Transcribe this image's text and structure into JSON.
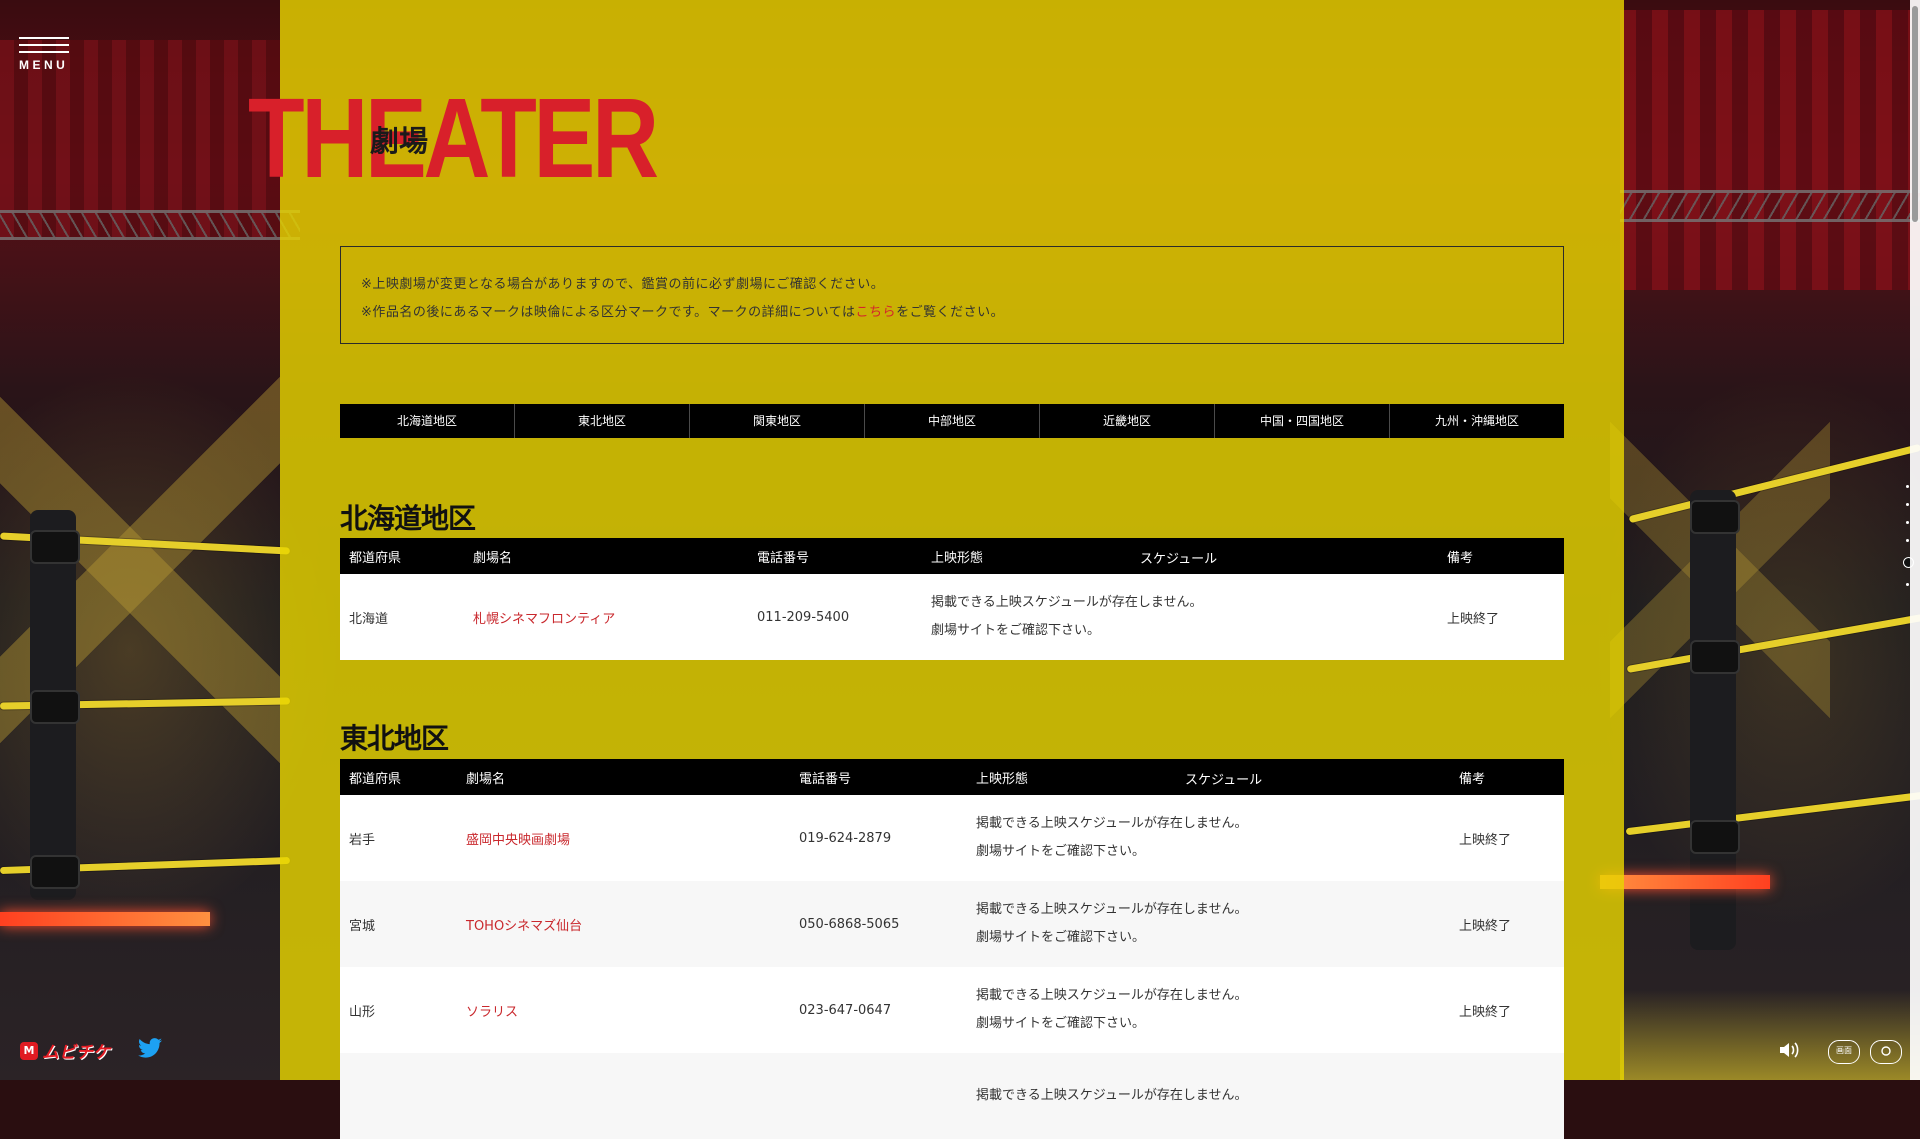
{
  "colors": {
    "accent": "#d8202a",
    "panel": "#e8d400",
    "header_bg": "#000000",
    "link": "#c9282d"
  },
  "menu": {
    "label": "MENU",
    "icon": "hamburger-icon"
  },
  "title": {
    "en": "THEATER",
    "jp": "劇場"
  },
  "notice": {
    "line1": "※上映劇場が変更となる場合がありますので、鑑賞の前に必ず劇場にご確認ください。",
    "line2_before": "※作品名の後にあるマークは映倫による区分マークです。マークの詳細については",
    "line2_link": "こちら",
    "line2_after": "をご覧ください。"
  },
  "tabs": [
    "北海道地区",
    "東北地区",
    "関東地区",
    "中部地区",
    "近畿地区",
    "中国・四国地区",
    "九州・沖縄地区"
  ],
  "columns": {
    "pref": "都道府県",
    "theater": "劇場名",
    "tel": "電話番号",
    "format": "上映形態",
    "schedule": "スケジュール",
    "note": "備考"
  },
  "regions": [
    {
      "name": "北海道地区",
      "rows": [
        {
          "pref": "北海道",
          "theater": "札幌シネマフロンティア",
          "tel": "011-209-5400",
          "sched1": "掲載できる上映スケジュールが存在しません。",
          "sched2": "劇場サイトをご確認下さい。",
          "note": "上映終了"
        }
      ]
    },
    {
      "name": "東北地区",
      "rows": [
        {
          "pref": "岩手",
          "theater": "盛岡中央映画劇場",
          "tel": "019-624-2879",
          "sched1": "掲載できる上映スケジュールが存在しません。",
          "sched2": "劇場サイトをご確認下さい。",
          "note": "上映終了"
        },
        {
          "pref": "宮城",
          "theater": "TOHOシネマズ仙台",
          "tel": "050-6868-5065",
          "sched1": "掲載できる上映スケジュールが存在しません。",
          "sched2": "劇場サイトをご確認下さい。",
          "note": "上映終了"
        },
        {
          "pref": "山形",
          "theater": "ソラリス",
          "tel": "023-647-0647",
          "sched1": "掲載できる上映スケジュールが存在しません。",
          "sched2": "劇場サイトをご確認下さい。",
          "note": "上映終了"
        },
        {
          "pref": "",
          "theater": "",
          "tel": "",
          "sched1": "掲載できる上映スケジュールが存在しません。",
          "sched2": "",
          "note": ""
        }
      ]
    }
  ],
  "footer": {
    "logo_text": "ムビチケ",
    "logo_mark": "M",
    "twitter_icon": "twitter-icon"
  },
  "controls": {
    "sound_icon": "speaker-icon",
    "c2_label": "画面",
    "c3_icon": "toggle-icon"
  }
}
